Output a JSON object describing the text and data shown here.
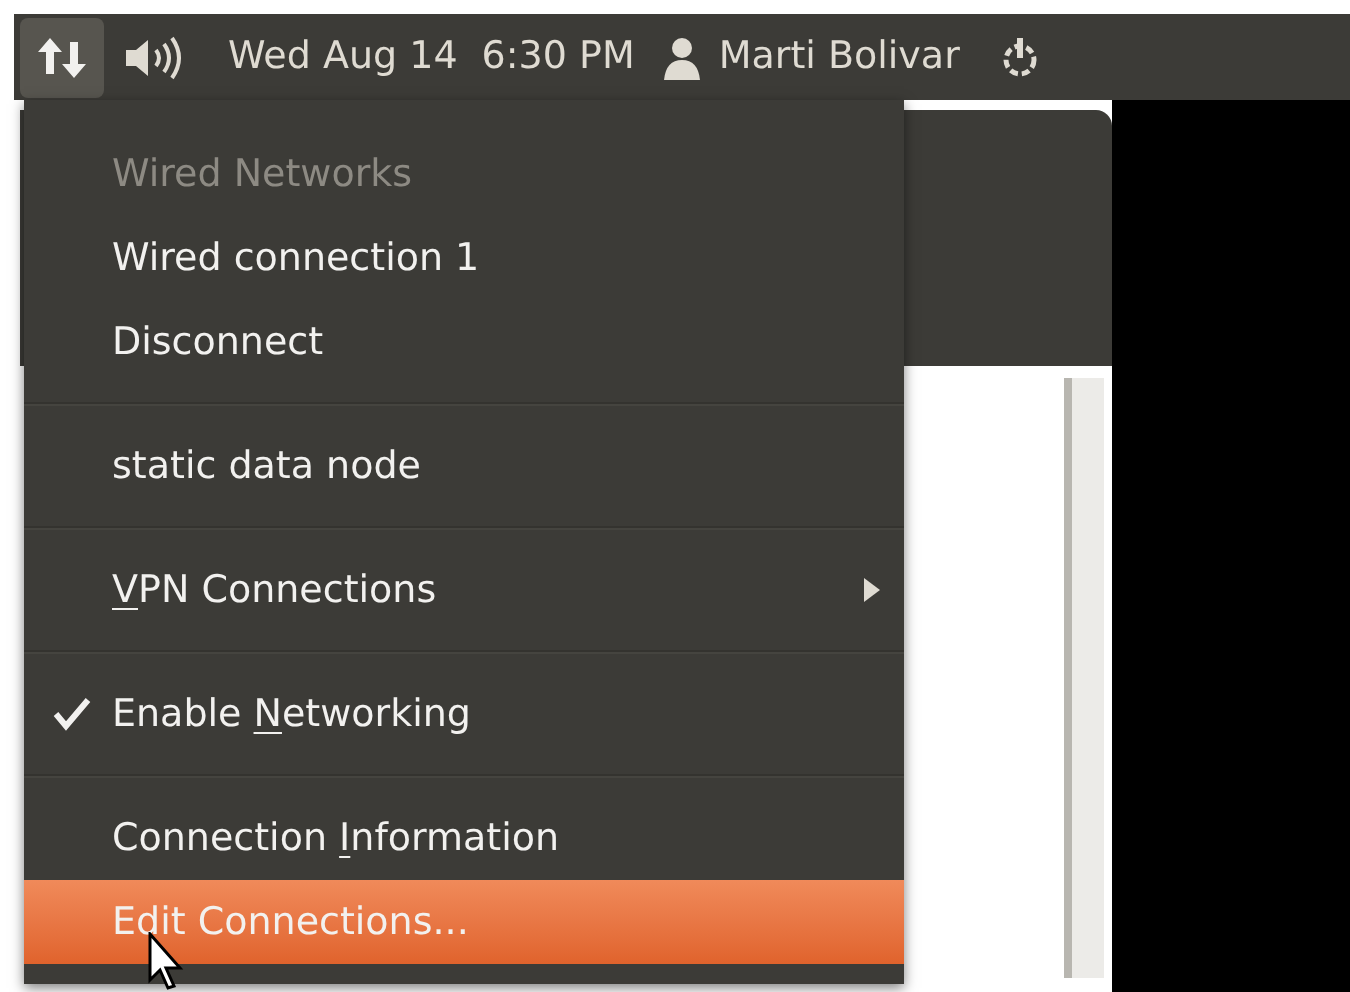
{
  "panel": {
    "indicators": [
      {
        "kind": "network",
        "active": true
      },
      {
        "kind": "volume",
        "active": false
      }
    ],
    "date": "Wed Aug 14",
    "time": "6:30 PM",
    "user": "Marti Bolivar"
  },
  "menu": {
    "items": [
      {
        "kind": "item",
        "after": "Wired Networks",
        "disabled": true,
        "highlighted": false
      },
      {
        "kind": "item",
        "after": "Wired connection 1",
        "disabled": false,
        "highlighted": false
      },
      {
        "kind": "item",
        "after": "Disconnect",
        "disabled": false,
        "highlighted": false
      },
      {
        "kind": "separator"
      },
      {
        "kind": "item",
        "after": "static data node",
        "disabled": false,
        "highlighted": false
      },
      {
        "kind": "separator"
      },
      {
        "kind": "submenu",
        "key": "V",
        "after": "PN Connections",
        "disabled": false,
        "highlighted": false
      },
      {
        "kind": "separator"
      },
      {
        "kind": "check",
        "before": "Enable ",
        "key": "N",
        "after": "etworking",
        "checked": true,
        "disabled": false,
        "highlighted": false
      },
      {
        "kind": "separator"
      },
      {
        "kind": "item",
        "before": "Connection ",
        "key": "I",
        "after": "nformation",
        "disabled": false,
        "highlighted": false
      },
      {
        "kind": "item",
        "before": "E",
        "after": "dit Connections...",
        "disabled": false,
        "highlighted": true
      }
    ]
  }
}
